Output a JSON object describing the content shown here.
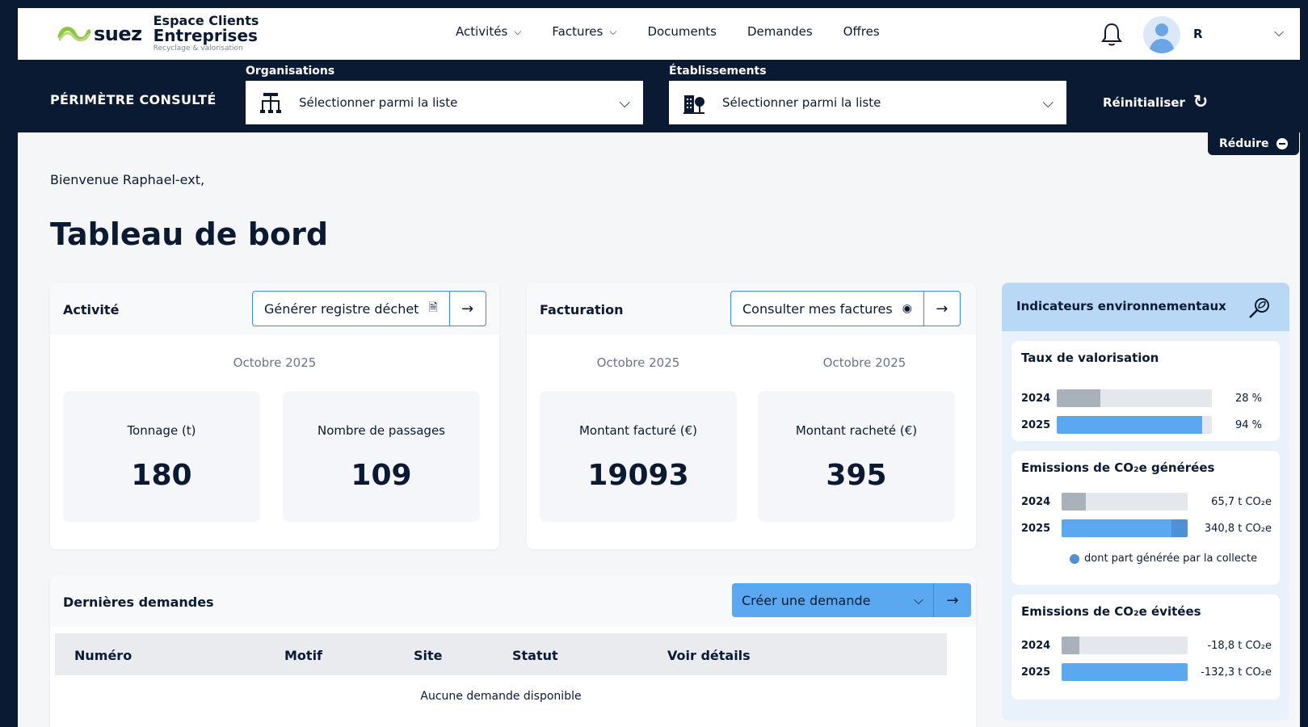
{
  "header": {
    "brand": "suez",
    "title_line1": "Espace Clients",
    "title_line2": "Entreprises",
    "tagline": "Recyclage & valorisation",
    "nav": [
      {
        "label": "Activités",
        "dropdown": true
      },
      {
        "label": "Factures",
        "dropdown": true
      },
      {
        "label": "Documents",
        "dropdown": false
      },
      {
        "label": "Demandes",
        "dropdown": false
      },
      {
        "label": "Offres",
        "dropdown": false
      }
    ],
    "user_initial": "R",
    "icons": {
      "bell": "bell-icon",
      "avatar": "user-avatar",
      "chevron": "chevron-down-icon"
    }
  },
  "perimetre": {
    "label": "PÉRIMÈTRE CONSULTÉ",
    "organisations": {
      "label": "Organisations",
      "placeholder": "Sélectionner parmi la liste"
    },
    "etablissements": {
      "label": "Établissements",
      "placeholder": "Sélectionner parmi la liste"
    },
    "reset_label": "Réinitialiser",
    "reduce_label": "Réduire"
  },
  "main": {
    "welcome": "Bienvenue Raphael-ext,",
    "title": "Tableau de bord"
  },
  "activite": {
    "title": "Activité",
    "button": "Générer registre déchet",
    "period": "Octobre 2025",
    "kpis": [
      {
        "label": "Tonnage (t)",
        "value": "180"
      },
      {
        "label": "Nombre de passages",
        "value": "109"
      }
    ]
  },
  "facturation": {
    "title": "Facturation",
    "button": "Consulter mes factures",
    "periods": [
      "Octobre 2025",
      "Octobre 2025"
    ],
    "kpis": [
      {
        "label": "Montant facturé (€)",
        "value": "19093"
      },
      {
        "label": "Montant racheté (€)",
        "value": "395"
      }
    ]
  },
  "demandes": {
    "title": "Dernières demandes",
    "button": "Créer une demande",
    "columns": [
      "Numéro",
      "Motif",
      "Site",
      "Statut",
      "Voir détails"
    ],
    "empty": "Aucune demande disponible"
  },
  "env": {
    "title": "Indicateurs environnementaux",
    "valorisation": {
      "title": "Taux de valorisation",
      "rows": [
        {
          "year": "2024",
          "value": "28 %",
          "pct": 28
        },
        {
          "year": "2025",
          "value": "94 %",
          "pct": 94
        }
      ]
    },
    "emissions": {
      "title": "Emissions de CO₂e générées",
      "rows": [
        {
          "year": "2024",
          "value": "65,7 t CO₂e",
          "pct": 19,
          "collecte_pct": 0
        },
        {
          "year": "2025",
          "value": "340,8 t CO₂e",
          "pct": 100,
          "collecte_pct": 13
        }
      ],
      "legend": "dont part générée par la collecte"
    },
    "evitees": {
      "title": "Emissions de CO₂e évitées",
      "rows": [
        {
          "year": "2024",
          "value": "-18,8 t CO₂e",
          "pct": 14
        },
        {
          "year": "2025",
          "value": "-132,3 t CO₂e",
          "pct": 100
        }
      ]
    }
  },
  "colors": {
    "navy": "#0b1a33",
    "blue": "#5aa8f0",
    "blue_dark": "#4f91d9",
    "grey_bar": "#a9b1bb",
    "accent_green": "#8cc63f"
  }
}
